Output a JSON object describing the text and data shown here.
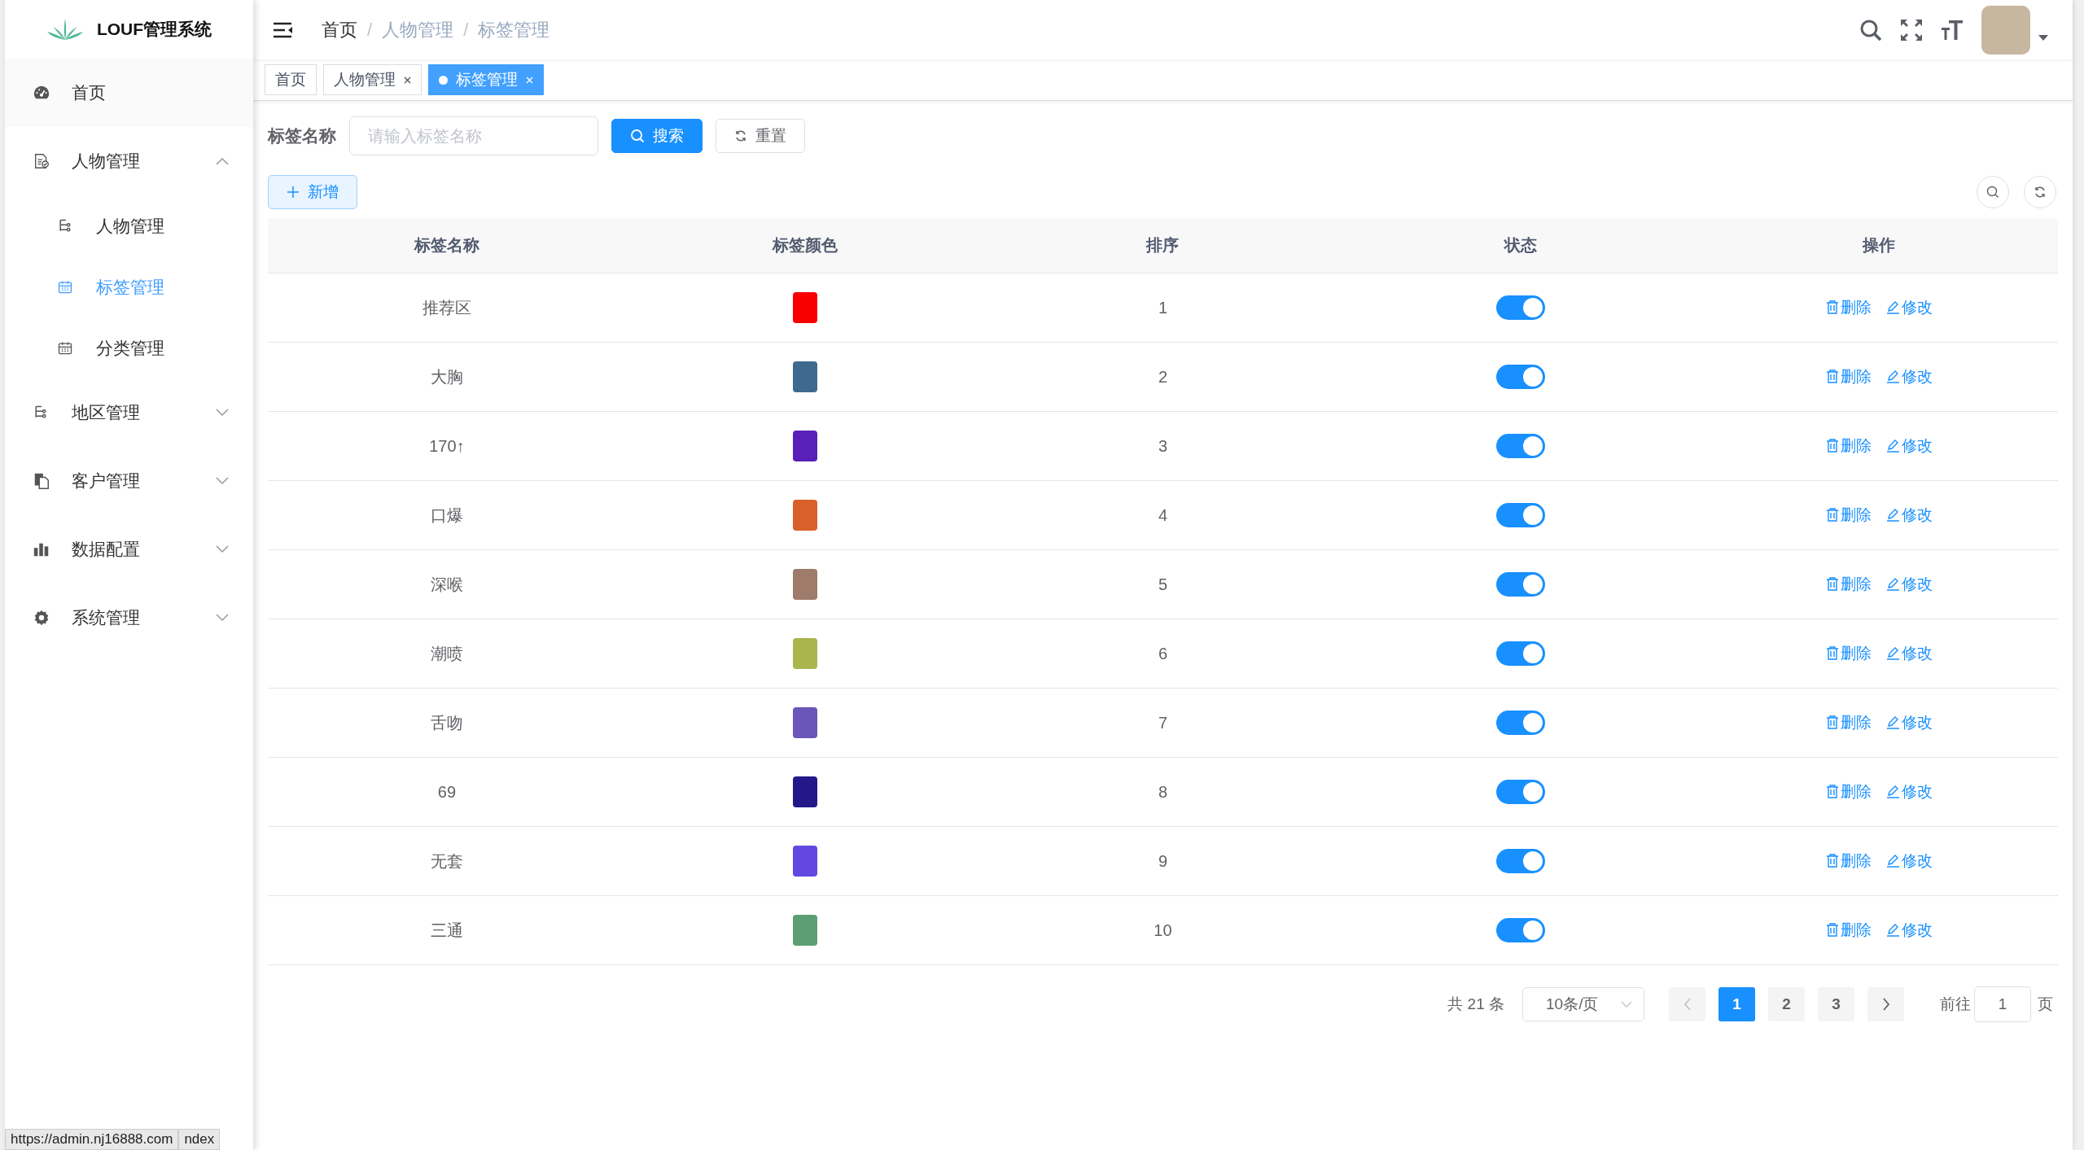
{
  "sidebar": {
    "logo_text": "LOUF管理系统",
    "items": [
      {
        "label": "首页",
        "selected": false
      },
      {
        "label": "人物管理",
        "selected": false,
        "expanded": true,
        "children": [
          {
            "label": "人物管理",
            "selected": false
          },
          {
            "label": "标签管理",
            "selected": true
          },
          {
            "label": "分类管理",
            "selected": false
          }
        ]
      },
      {
        "label": "地区管理",
        "selected": false,
        "expanded": false
      },
      {
        "label": "客户管理",
        "selected": false,
        "expanded": false
      },
      {
        "label": "数据配置",
        "selected": false,
        "expanded": false
      },
      {
        "label": "系统管理",
        "selected": false,
        "expanded": false
      }
    ]
  },
  "breadcrumb": [
    "首页",
    "/",
    "人物管理",
    "/",
    "标签管理"
  ],
  "tags_view": [
    {
      "label": "首页",
      "selected": false,
      "closable": false
    },
    {
      "label": "人物管理",
      "selected": false,
      "closable": true
    },
    {
      "label": "标签管理",
      "selected": true,
      "closable": true
    }
  ],
  "search": {
    "label": "标签名称",
    "placeholder": "请输入标签名称",
    "search_button": "搜索",
    "reset_button": "重置"
  },
  "add_button": "新增",
  "table": {
    "columns": [
      "标签名称",
      "标签颜色",
      "排序",
      "状态",
      "操作"
    ],
    "rows": [
      {
        "name": "推荐区",
        "color": "#f80000",
        "sort": "1",
        "enabled": true,
        "actions": [
          "删除",
          "修改"
        ]
      },
      {
        "name": "大胸",
        "color": "#3f6a8f",
        "sort": "2",
        "enabled": true,
        "actions": [
          "删除",
          "修改"
        ]
      },
      {
        "name": "170↑",
        "color": "#5a1fb8",
        "sort": "3",
        "enabled": true,
        "actions": [
          "删除",
          "修改"
        ]
      },
      {
        "name": "口爆",
        "color": "#d9602a",
        "sort": "4",
        "enabled": true,
        "actions": [
          "删除",
          "修改"
        ]
      },
      {
        "name": "深喉",
        "color": "#9e7b6b",
        "sort": "5",
        "enabled": true,
        "actions": [
          "删除",
          "修改"
        ]
      },
      {
        "name": "潮喷",
        "color": "#abb54e",
        "sort": "6",
        "enabled": true,
        "actions": [
          "删除",
          "修改"
        ]
      },
      {
        "name": "舌吻",
        "color": "#6a55b9",
        "sort": "7",
        "enabled": true,
        "actions": [
          "删除",
          "修改"
        ]
      },
      {
        "name": "69",
        "color": "#23188a",
        "sort": "8",
        "enabled": true,
        "actions": [
          "删除",
          "修改"
        ]
      },
      {
        "name": "无套",
        "color": "#6248e0",
        "sort": "9",
        "enabled": true,
        "actions": [
          "删除",
          "修改"
        ]
      },
      {
        "name": "三通",
        "color": "#5e9e74",
        "sort": "10",
        "enabled": true,
        "actions": [
          "删除",
          "修改"
        ]
      }
    ]
  },
  "pagination": {
    "total": "共 21 条",
    "page_size": "10条/页",
    "pages": [
      {
        "label": "1",
        "selected": true
      },
      {
        "label": "2",
        "selected": false
      },
      {
        "label": "3",
        "selected": false
      }
    ],
    "goto_label": "前往",
    "goto_value": "1",
    "page_unit": "页"
  },
  "status_url": [
    "https://admin.nj16888.com",
    "ndex"
  ]
}
